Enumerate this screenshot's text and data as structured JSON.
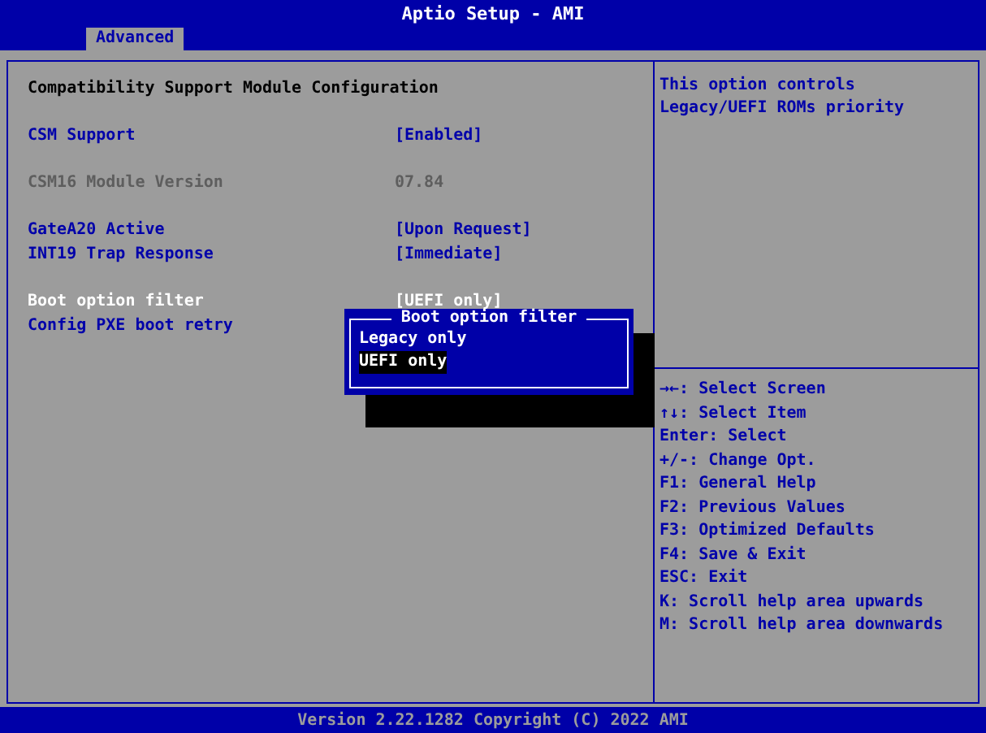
{
  "window": {
    "title": "Aptio Setup - AMI"
  },
  "tabs": [
    {
      "label": "Advanced",
      "selected": true
    }
  ],
  "settings": {
    "groups": [
      {
        "items": [
          {
            "kind": "heading",
            "label": "Compatibility Support Module Configuration"
          }
        ]
      },
      {
        "items": [
          {
            "kind": "option",
            "label": "CSM Support",
            "value": "[Enabled]",
            "selected": false
          }
        ]
      },
      {
        "items": [
          {
            "kind": "disabled",
            "label": "CSM16 Module Version",
            "value": "07.84"
          }
        ]
      },
      {
        "items": [
          {
            "kind": "option",
            "label": "GateA20 Active",
            "value": "[Upon Request]",
            "selected": false
          },
          {
            "kind": "option",
            "label": "INT19 Trap Response",
            "value": "[Immediate]",
            "selected": false
          }
        ]
      },
      {
        "items": [
          {
            "kind": "option",
            "label": "Boot option filter",
            "value": "[UEFI only]",
            "selected": true
          },
          {
            "kind": "option",
            "label": "Config PXE boot retry",
            "selected": false
          }
        ]
      }
    ]
  },
  "popup": {
    "title": "Boot option filter",
    "options": [
      {
        "label": "Legacy only",
        "selected": false
      },
      {
        "label": "UEFI only",
        "selected": true
      }
    ]
  },
  "help": {
    "description": "This option controls Legacy/UEFI ROMs priority"
  },
  "keys": [
    "→←: Select Screen",
    "↑↓: Select Item",
    "Enter: Select",
    "+/-: Change Opt.",
    "F1: General Help",
    "F2: Previous Values",
    "F3: Optimized Defaults",
    "F4: Save & Exit",
    "ESC: Exit",
    "K: Scroll help area upwards",
    "M: Scroll help area downwards"
  ],
  "status_bar": {
    "text": "Version 2.22.1282 Copyright (C) 2022 AMI"
  }
}
